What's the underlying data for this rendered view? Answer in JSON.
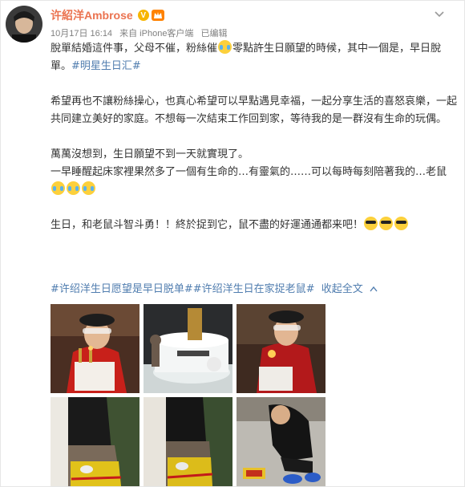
{
  "post": {
    "author": "许紹洋Ambrose",
    "verified_badge": "V",
    "date": "10月17日 16:14",
    "source": "来自 iPhone客户端",
    "edited": "已编辑",
    "paragraphs": [
      {
        "text": "脫單結婚這件事，父母不催，粉絲催",
        "tail": "零點許生日願望的時候，其中一個是，早日脫單。",
        "topic": "#明星生日汇#"
      },
      {
        "text": "希望再也不讓粉絲操心，也真心希望可以早點遇見幸福，一起分享生活的喜怒哀樂，一起共同建立美好的家庭。不想每一次結束工作回到家，等待我的是一群沒有生命的玩偶。"
      },
      {
        "line1": "萬萬沒想到，生日願望不到一天就實現了。",
        "line2": "一早睡醒起床家裡果然多了一個有生命的…有靈氣的……可以每時每刻陪著我的…老鼠"
      },
      {
        "text": "生日，和老鼠斗智斗勇！！終於捉到它，鼠不盡的好運通通都来吧！"
      }
    ],
    "hashtags": "#许绍洋生日愿望是早日脱单##许绍洋生日在家捉老鼠#",
    "collapse_label": "收起全文"
  },
  "icons": {
    "emoji_sweat": "sweat-smile-emoji",
    "emoji_tears": "tears-of-joy-emoji",
    "emoji_cool": "sunglasses-emoji",
    "menu": "chevron-down-icon",
    "collapse": "chevron-up-icon"
  },
  "colors": {
    "username": "#eb7350",
    "link": "#507daf",
    "meta": "#808080"
  }
}
